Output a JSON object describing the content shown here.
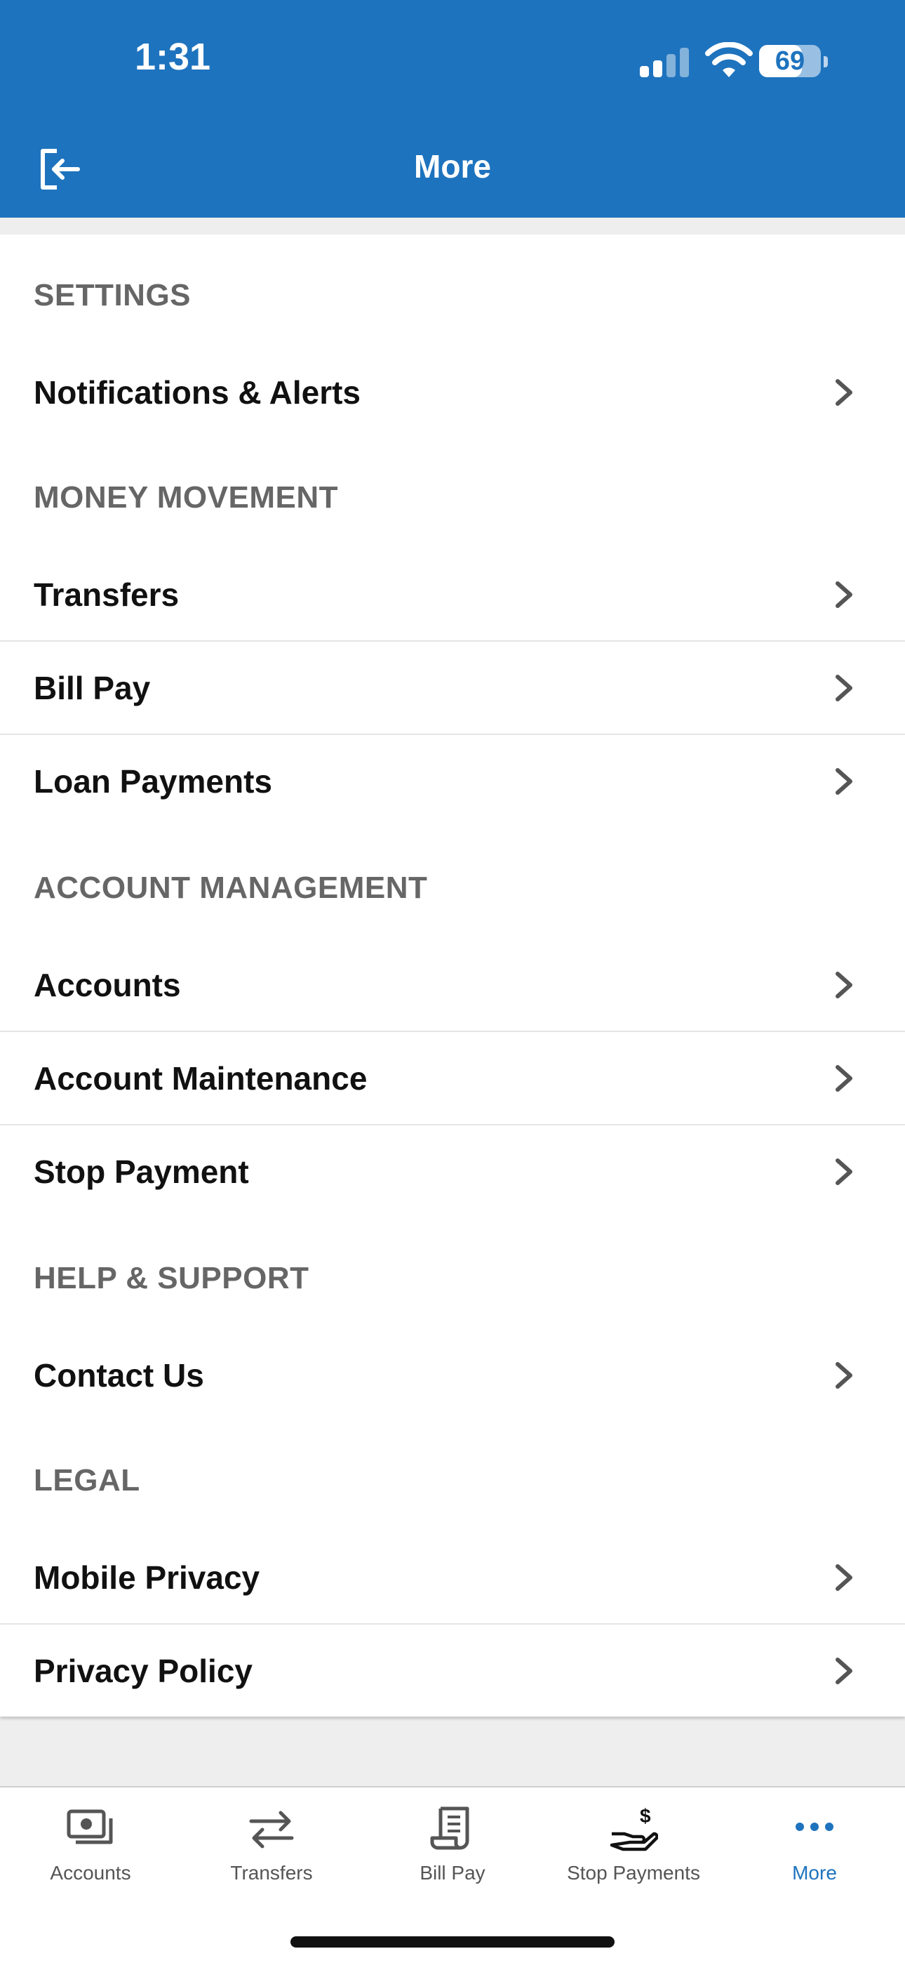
{
  "status_bar": {
    "time": "1:31",
    "battery": "69",
    "battery_level": 0.69
  },
  "header": {
    "title": "More"
  },
  "sections": [
    {
      "title": "SETTINGS",
      "items": [
        "Notifications & Alerts"
      ]
    },
    {
      "title": "MONEY MOVEMENT",
      "items": [
        "Transfers",
        "Bill Pay",
        "Loan Payments"
      ]
    },
    {
      "title": "ACCOUNT MANAGEMENT",
      "items": [
        "Accounts",
        "Account Maintenance",
        "Stop Payment"
      ]
    },
    {
      "title": "HELP & SUPPORT",
      "items": [
        "Contact Us"
      ]
    },
    {
      "title": "LEGAL",
      "items": [
        "Mobile Privacy",
        "Privacy Policy"
      ]
    }
  ],
  "tabbar": {
    "tabs": [
      {
        "label": "Accounts",
        "icon": "accounts-icon"
      },
      {
        "label": "Transfers",
        "icon": "transfers-icon"
      },
      {
        "label": "Bill Pay",
        "icon": "bill-pay-icon"
      },
      {
        "label": "Stop Payments",
        "icon": "stop-payments-icon"
      },
      {
        "label": "More",
        "icon": "more-icon",
        "active": true
      }
    ]
  },
  "colors": {
    "brand": "#1e73be",
    "background": "#eeeeee",
    "section_title": "#666666"
  }
}
